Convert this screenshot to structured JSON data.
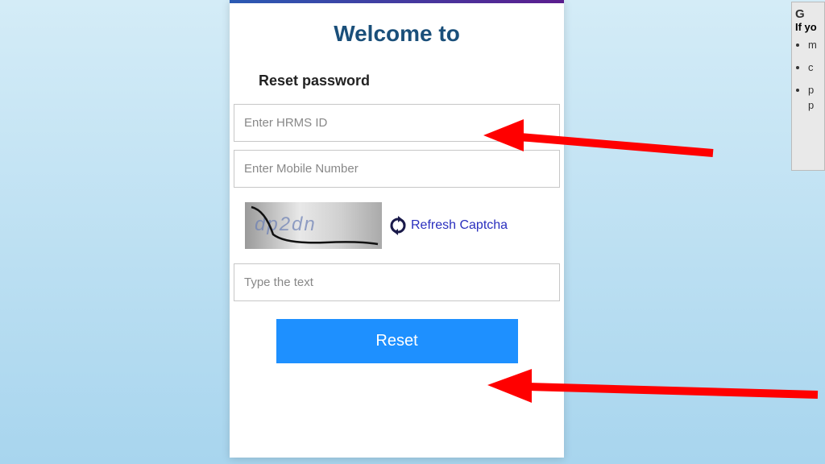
{
  "header": {
    "welcome": "Welcome to"
  },
  "form": {
    "subtitle": "Reset password",
    "hrms_placeholder": "Enter HRMS ID",
    "mobile_placeholder": "Enter Mobile Number",
    "captcha_value": "dp2dn",
    "refresh_label": "Refresh Captcha",
    "captcha_input_placeholder": "Type the text",
    "reset_label": "Reset"
  },
  "side": {
    "heading": "G",
    "subheading": "If yo",
    "items": [
      "m",
      "c",
      "p p"
    ]
  }
}
